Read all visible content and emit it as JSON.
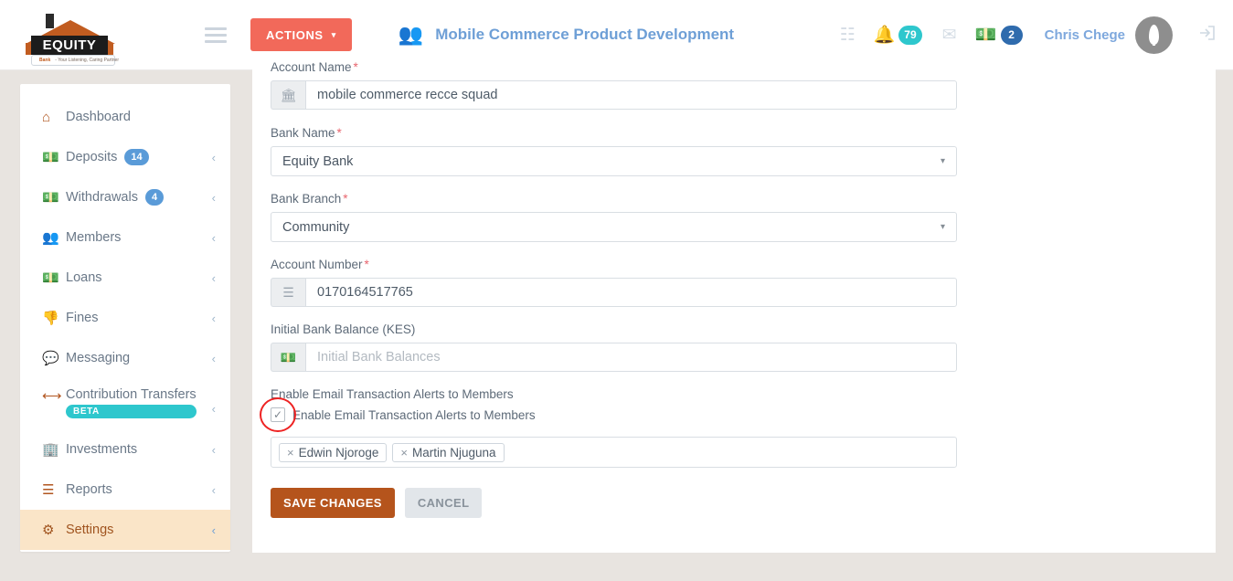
{
  "topbar": {
    "logo": {
      "name": "EQUITY",
      "sub_bold": "Bank",
      "sub_rest": "- Your Listening, Caring Partner"
    },
    "menu_toggle": "menu-toggle",
    "actions_label": "ACTIONS",
    "actions_caret": "▾",
    "group_icon": "👥",
    "page_title": "Mobile Commerce Product Development",
    "calendar_icon": "☷",
    "bell_icon": "🔔",
    "bell_count": "79",
    "envelope_icon": "✉",
    "money_icon": "💵",
    "money_count": "2",
    "username": "Chris Chege",
    "logout_icon": "→]",
    "accent_actions": "#f2695a",
    "accent_title": "#6e9fd6",
    "badge_teal": "#2ec7cd",
    "badge_blue": "#2f6bad"
  },
  "sidebar": {
    "items": [
      {
        "label": "Dashboard",
        "icon": "home-icon",
        "glyph": "⌂",
        "badge": null,
        "chevron": false,
        "active": false
      },
      {
        "label": "Deposits",
        "icon": "money-icon",
        "glyph": "💵",
        "badge": "14",
        "chevron": true,
        "active": false
      },
      {
        "label": "Withdrawals",
        "icon": "money-icon",
        "glyph": "💵",
        "badge": "4",
        "chevron": true,
        "active": false
      },
      {
        "label": "Members",
        "icon": "users-icon",
        "glyph": "👥",
        "badge": null,
        "chevron": true,
        "active": false
      },
      {
        "label": "Loans",
        "icon": "money-icon",
        "glyph": "💵",
        "badge": null,
        "chevron": true,
        "active": false
      },
      {
        "label": "Fines",
        "icon": "thumbs-down-icon",
        "glyph": "👎",
        "badge": null,
        "chevron": true,
        "active": false
      },
      {
        "label": "Messaging",
        "icon": "chat-bubbles-icon",
        "glyph": "💬",
        "badge": null,
        "chevron": true,
        "active": false
      },
      {
        "label": "Contribution Transfers",
        "icon": "arrows-left-right-icon",
        "glyph": "⟷",
        "badge": "BETA",
        "chevron": true,
        "active": false
      },
      {
        "label": "Investments",
        "icon": "building-icon",
        "glyph": "🏢",
        "badge": null,
        "chevron": true,
        "active": false
      },
      {
        "label": "Reports",
        "icon": "bars-icon",
        "glyph": "☰",
        "badge": null,
        "chevron": true,
        "active": false
      },
      {
        "label": "Settings",
        "icon": "gears-icon",
        "glyph": "⚙",
        "badge": null,
        "chevron": true,
        "active": true
      }
    ],
    "chevron_glyph": "‹",
    "active_bg": "#fae5c8",
    "active_color": "#a0541f",
    "icon_color": "#b1551f"
  },
  "form": {
    "account_name": {
      "label": "Account Name",
      "required": "*",
      "value": "mobile commerce recce squad",
      "icon": "bank-icon",
      "icon_glyph": "🏛"
    },
    "bank_name": {
      "label": "Bank Name",
      "required": "*",
      "value": "Equity Bank",
      "caret": "▾"
    },
    "bank_branch": {
      "label": "Bank Branch",
      "required": "*",
      "value": "Community",
      "caret": "▾"
    },
    "account_number": {
      "label": "Account Number",
      "required": "*",
      "value": "0170164517765",
      "icon": "list-icon",
      "icon_glyph": "☰"
    },
    "initial_balance": {
      "label": "Initial Bank Balance (KES)",
      "value": "",
      "placeholder": "Initial Bank Balances",
      "icon": "money-icon",
      "icon_glyph": "💵"
    },
    "email_alerts": {
      "section_label": "Enable Email Transaction Alerts to Members",
      "checkbox_label": "Enable Email Transaction Alerts to Members",
      "checked": true,
      "check_glyph": "✓",
      "annotation_color": "#ee2222"
    },
    "members_tags": {
      "remove_glyph": "×",
      "tags": [
        "Edwin Njoroge",
        "Martin Njuguna"
      ]
    },
    "buttons": {
      "save_label": "SAVE CHANGES",
      "cancel_label": "CANCEL",
      "save_color": "#b5541c"
    }
  }
}
